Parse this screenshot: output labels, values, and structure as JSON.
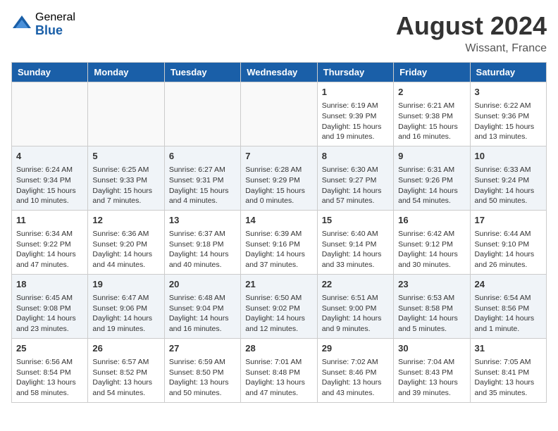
{
  "header": {
    "logo_general": "General",
    "logo_blue": "Blue",
    "title": "August 2024",
    "location": "Wissant, France"
  },
  "days_of_week": [
    "Sunday",
    "Monday",
    "Tuesday",
    "Wednesday",
    "Thursday",
    "Friday",
    "Saturday"
  ],
  "weeks": [
    [
      {
        "day": "",
        "empty": true
      },
      {
        "day": "",
        "empty": true
      },
      {
        "day": "",
        "empty": true
      },
      {
        "day": "",
        "empty": true
      },
      {
        "day": "1",
        "line1": "Sunrise: 6:19 AM",
        "line2": "Sunset: 9:39 PM",
        "line3": "Daylight: 15 hours",
        "line4": "and 19 minutes."
      },
      {
        "day": "2",
        "line1": "Sunrise: 6:21 AM",
        "line2": "Sunset: 9:38 PM",
        "line3": "Daylight: 15 hours",
        "line4": "and 16 minutes."
      },
      {
        "day": "3",
        "line1": "Sunrise: 6:22 AM",
        "line2": "Sunset: 9:36 PM",
        "line3": "Daylight: 15 hours",
        "line4": "and 13 minutes."
      }
    ],
    [
      {
        "day": "4",
        "line1": "Sunrise: 6:24 AM",
        "line2": "Sunset: 9:34 PM",
        "line3": "Daylight: 15 hours",
        "line4": "and 10 minutes."
      },
      {
        "day": "5",
        "line1": "Sunrise: 6:25 AM",
        "line2": "Sunset: 9:33 PM",
        "line3": "Daylight: 15 hours",
        "line4": "and 7 minutes."
      },
      {
        "day": "6",
        "line1": "Sunrise: 6:27 AM",
        "line2": "Sunset: 9:31 PM",
        "line3": "Daylight: 15 hours",
        "line4": "and 4 minutes."
      },
      {
        "day": "7",
        "line1": "Sunrise: 6:28 AM",
        "line2": "Sunset: 9:29 PM",
        "line3": "Daylight: 15 hours",
        "line4": "and 0 minutes."
      },
      {
        "day": "8",
        "line1": "Sunrise: 6:30 AM",
        "line2": "Sunset: 9:27 PM",
        "line3": "Daylight: 14 hours",
        "line4": "and 57 minutes."
      },
      {
        "day": "9",
        "line1": "Sunrise: 6:31 AM",
        "line2": "Sunset: 9:26 PM",
        "line3": "Daylight: 14 hours",
        "line4": "and 54 minutes."
      },
      {
        "day": "10",
        "line1": "Sunrise: 6:33 AM",
        "line2": "Sunset: 9:24 PM",
        "line3": "Daylight: 14 hours",
        "line4": "and 50 minutes."
      }
    ],
    [
      {
        "day": "11",
        "line1": "Sunrise: 6:34 AM",
        "line2": "Sunset: 9:22 PM",
        "line3": "Daylight: 14 hours",
        "line4": "and 47 minutes."
      },
      {
        "day": "12",
        "line1": "Sunrise: 6:36 AM",
        "line2": "Sunset: 9:20 PM",
        "line3": "Daylight: 14 hours",
        "line4": "and 44 minutes."
      },
      {
        "day": "13",
        "line1": "Sunrise: 6:37 AM",
        "line2": "Sunset: 9:18 PM",
        "line3": "Daylight: 14 hours",
        "line4": "and 40 minutes."
      },
      {
        "day": "14",
        "line1": "Sunrise: 6:39 AM",
        "line2": "Sunset: 9:16 PM",
        "line3": "Daylight: 14 hours",
        "line4": "and 37 minutes."
      },
      {
        "day": "15",
        "line1": "Sunrise: 6:40 AM",
        "line2": "Sunset: 9:14 PM",
        "line3": "Daylight: 14 hours",
        "line4": "and 33 minutes."
      },
      {
        "day": "16",
        "line1": "Sunrise: 6:42 AM",
        "line2": "Sunset: 9:12 PM",
        "line3": "Daylight: 14 hours",
        "line4": "and 30 minutes."
      },
      {
        "day": "17",
        "line1": "Sunrise: 6:44 AM",
        "line2": "Sunset: 9:10 PM",
        "line3": "Daylight: 14 hours",
        "line4": "and 26 minutes."
      }
    ],
    [
      {
        "day": "18",
        "line1": "Sunrise: 6:45 AM",
        "line2": "Sunset: 9:08 PM",
        "line3": "Daylight: 14 hours",
        "line4": "and 23 minutes."
      },
      {
        "day": "19",
        "line1": "Sunrise: 6:47 AM",
        "line2": "Sunset: 9:06 PM",
        "line3": "Daylight: 14 hours",
        "line4": "and 19 minutes."
      },
      {
        "day": "20",
        "line1": "Sunrise: 6:48 AM",
        "line2": "Sunset: 9:04 PM",
        "line3": "Daylight: 14 hours",
        "line4": "and 16 minutes."
      },
      {
        "day": "21",
        "line1": "Sunrise: 6:50 AM",
        "line2": "Sunset: 9:02 PM",
        "line3": "Daylight: 14 hours",
        "line4": "and 12 minutes."
      },
      {
        "day": "22",
        "line1": "Sunrise: 6:51 AM",
        "line2": "Sunset: 9:00 PM",
        "line3": "Daylight: 14 hours",
        "line4": "and 9 minutes."
      },
      {
        "day": "23",
        "line1": "Sunrise: 6:53 AM",
        "line2": "Sunset: 8:58 PM",
        "line3": "Daylight: 14 hours",
        "line4": "and 5 minutes."
      },
      {
        "day": "24",
        "line1": "Sunrise: 6:54 AM",
        "line2": "Sunset: 8:56 PM",
        "line3": "Daylight: 14 hours",
        "line4": "and 1 minute."
      }
    ],
    [
      {
        "day": "25",
        "line1": "Sunrise: 6:56 AM",
        "line2": "Sunset: 8:54 PM",
        "line3": "Daylight: 13 hours",
        "line4": "and 58 minutes."
      },
      {
        "day": "26",
        "line1": "Sunrise: 6:57 AM",
        "line2": "Sunset: 8:52 PM",
        "line3": "Daylight: 13 hours",
        "line4": "and 54 minutes."
      },
      {
        "day": "27",
        "line1": "Sunrise: 6:59 AM",
        "line2": "Sunset: 8:50 PM",
        "line3": "Daylight: 13 hours",
        "line4": "and 50 minutes."
      },
      {
        "day": "28",
        "line1": "Sunrise: 7:01 AM",
        "line2": "Sunset: 8:48 PM",
        "line3": "Daylight: 13 hours",
        "line4": "and 47 minutes."
      },
      {
        "day": "29",
        "line1": "Sunrise: 7:02 AM",
        "line2": "Sunset: 8:46 PM",
        "line3": "Daylight: 13 hours",
        "line4": "and 43 minutes."
      },
      {
        "day": "30",
        "line1": "Sunrise: 7:04 AM",
        "line2": "Sunset: 8:43 PM",
        "line3": "Daylight: 13 hours",
        "line4": "and 39 minutes."
      },
      {
        "day": "31",
        "line1": "Sunrise: 7:05 AM",
        "line2": "Sunset: 8:41 PM",
        "line3": "Daylight: 13 hours",
        "line4": "and 35 minutes."
      }
    ]
  ]
}
